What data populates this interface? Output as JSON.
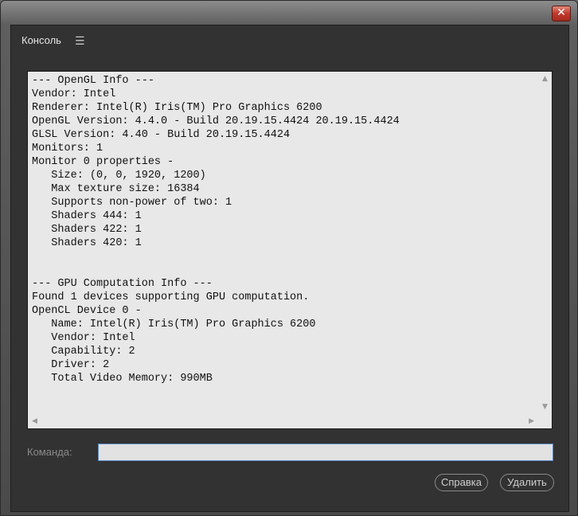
{
  "window": {
    "close_label": "✕"
  },
  "panel": {
    "title": "Консоль",
    "menu_icon": "☰"
  },
  "console": {
    "lines": [
      "--- OpenGL Info ---",
      "Vendor: Intel",
      "Renderer: Intel(R) Iris(TM) Pro Graphics 6200",
      "OpenGL Version: 4.4.0 - Build 20.19.15.4424 20.19.15.4424",
      "GLSL Version: 4.40 - Build 20.19.15.4424",
      "Monitors: 1",
      "Monitor 0 properties -",
      "   Size: (0, 0, 1920, 1200)",
      "   Max texture size: 16384",
      "   Supports non-power of two: 1",
      "   Shaders 444: 1",
      "   Shaders 422: 1",
      "   Shaders 420: 1",
      "",
      "",
      "--- GPU Computation Info ---",
      "Found 1 devices supporting GPU computation.",
      "OpenCL Device 0 -",
      "   Name: Intel(R) Iris(TM) Pro Graphics 6200",
      "   Vendor: Intel",
      "   Capability: 2",
      "   Driver: 2",
      "   Total Video Memory: 990MB"
    ],
    "scroll_up": "▲",
    "scroll_down": "▼",
    "scroll_left": "◀",
    "scroll_right": "▶"
  },
  "command": {
    "label": "Команда:",
    "value": ""
  },
  "buttons": {
    "help": "Справка",
    "delete": "Удалить"
  }
}
